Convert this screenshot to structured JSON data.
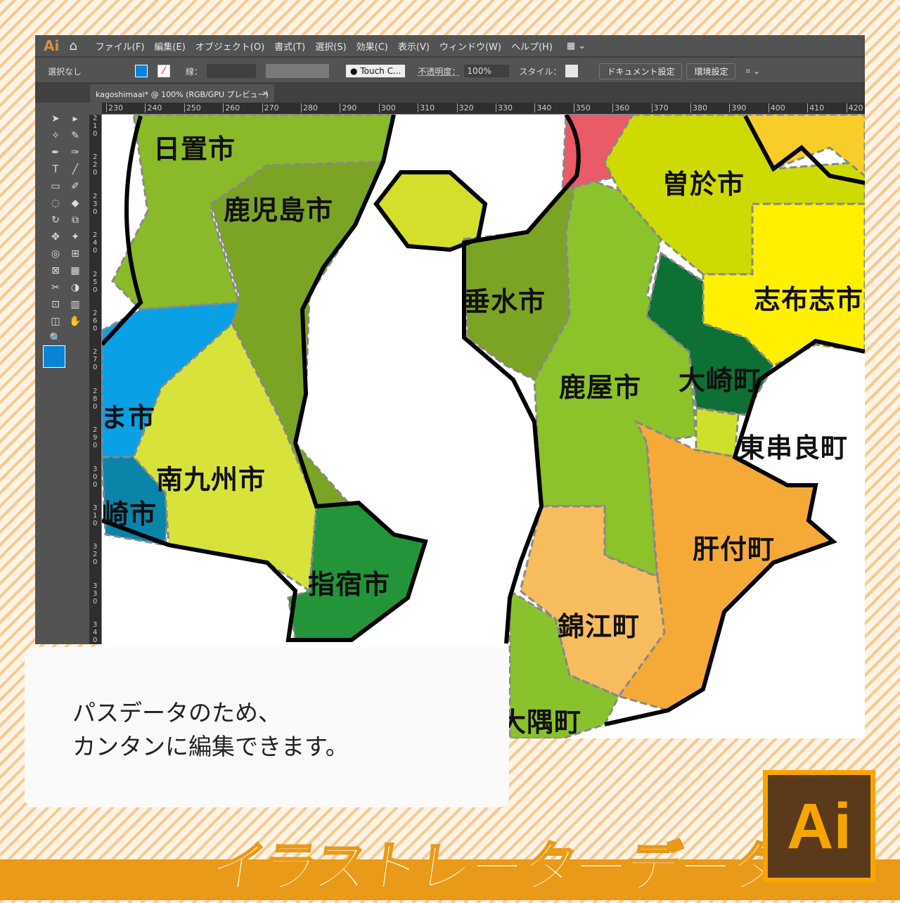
{
  "app": {
    "logo": "Ai",
    "home_icon": "home-icon"
  },
  "menu": [
    "ファイル(F)",
    "編集(E)",
    "オブジェクト(O)",
    "書式(T)",
    "選択(S)",
    "効果(C)",
    "表示(V)",
    "ウィンドウ(W)",
    "ヘルプ(H)"
  ],
  "control": {
    "selection": "選択なし",
    "fill_color": "#0a84d6",
    "stroke_label": "線：",
    "brush": "Touch C...",
    "opacity_label": "不透明度：",
    "opacity": "100%",
    "style_label": "スタイル：",
    "doc_settings": "ドキュメント設定",
    "preferences": "環境設定"
  },
  "tab": {
    "title": "kagoshimaai* @ 100% (RGB/GPU プレビュー)",
    "close": "×"
  },
  "hruler": [
    "230",
    "240",
    "250",
    "260",
    "270",
    "280",
    "290",
    "300",
    "310",
    "320",
    "330",
    "340",
    "350",
    "360",
    "370",
    "380",
    "390",
    "400",
    "410",
    "420"
  ],
  "vruler": [
    "210",
    "220",
    "230",
    "240",
    "250",
    "260",
    "270",
    "280",
    "290",
    "300",
    "310",
    "320",
    "330",
    "340"
  ],
  "map": {
    "labels": [
      "日置市",
      "鹿児島市",
      "曽於市",
      "垂水市",
      "志布志市",
      "大崎町",
      "鹿屋市",
      "東串良町",
      "ま市",
      "南九州市",
      "崎市",
      "肝付町",
      "指宿市",
      "錦江町",
      "大隅町"
    ]
  },
  "note": {
    "line1": "パスデータのため、",
    "line2": "カンタンに編集できます。"
  },
  "banner": {
    "title": "イラストレーターデータ",
    "logo": "Ai"
  },
  "colors": {
    "accent": "#e89a18",
    "stripe": "#f7c98e"
  }
}
